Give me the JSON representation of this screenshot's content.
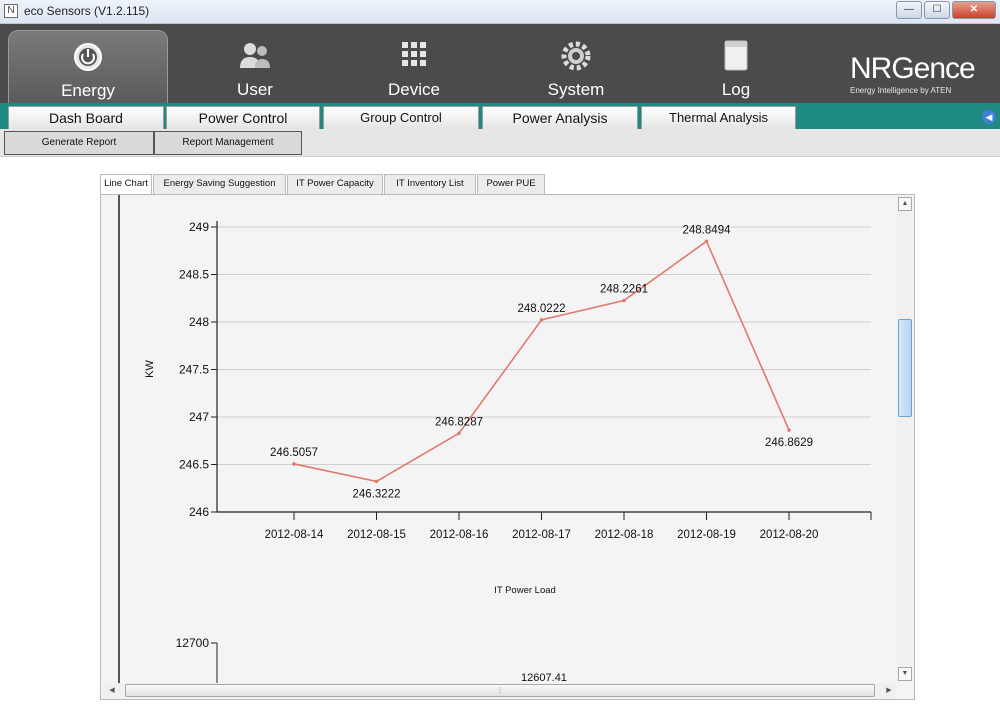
{
  "window": {
    "title": "eco Sensors (V1.2.115)",
    "buttons": [
      "—",
      "☐",
      "✕"
    ]
  },
  "nav": {
    "tabs": [
      {
        "label": "Energy",
        "icon": "power-icon",
        "active": true
      },
      {
        "label": "User",
        "icon": "users-icon",
        "active": false
      },
      {
        "label": "Device",
        "icon": "device-grid-icon",
        "active": false
      },
      {
        "label": "System",
        "icon": "gear-icon",
        "active": false
      },
      {
        "label": "Log",
        "icon": "log-document-icon",
        "active": false
      }
    ]
  },
  "logo": {
    "main": "NRGence",
    "sub": "Energy Intelligence by ATEN"
  },
  "function_tabs": [
    "Dash Board",
    "Power Control",
    "Group Control",
    "Power Analysis",
    "Thermal Analysis"
  ],
  "sub_tabs": [
    "Generate Report",
    "Report Management"
  ],
  "panel_tabs": [
    {
      "label": "Line Chart",
      "active": true
    },
    {
      "label": "Energy Saving Suggestion",
      "active": false
    },
    {
      "label": "IT Power Capacity",
      "active": false
    },
    {
      "label": "IT Inventory List",
      "active": false
    },
    {
      "label": "Power PUE",
      "active": false
    }
  ],
  "colors": {
    "header_bg": "#4b4b4b",
    "funcbar_bg": "#1e8a82",
    "line_color": "#e07a6e"
  },
  "chart_data": [
    {
      "type": "line",
      "title": "",
      "xlabel": "IT Power Load",
      "ylabel": "KW",
      "x": [
        "2012-08-14",
        "2012-08-15",
        "2012-08-16",
        "2012-08-17",
        "2012-08-18",
        "2012-08-19",
        "2012-08-20"
      ],
      "series": [
        {
          "values": [
            246.5057,
            246.3222,
            246.8287,
            248.0222,
            248.2261,
            248.8494,
            246.8629
          ]
        }
      ],
      "data_labels": [
        "246.5057",
        "246.3222",
        "246.8287",
        "248.0222",
        "248.2261",
        "248.8494",
        "246.8629"
      ],
      "ylim": [
        246,
        249
      ],
      "yticks": [
        "246",
        "246.5",
        "247",
        "247.5",
        "248",
        "248.5",
        "249"
      ],
      "grid": true,
      "legend": "none"
    },
    {
      "type": "line",
      "title": "",
      "ytick_top": "12700",
      "data_label_visible": "12607.41"
    }
  ]
}
